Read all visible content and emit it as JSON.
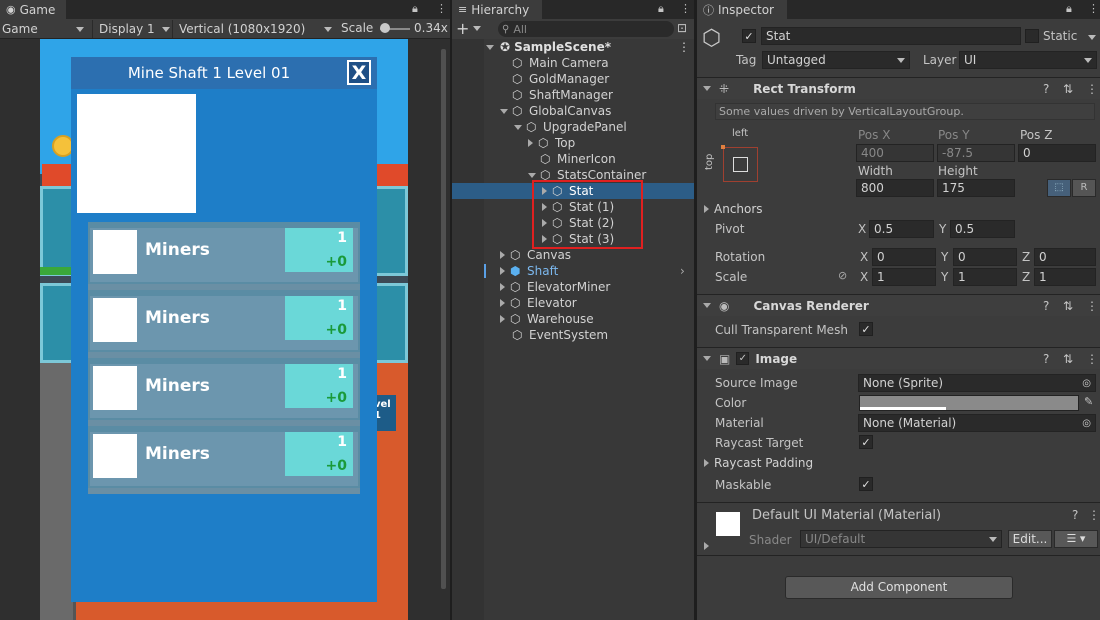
{
  "game": {
    "tab_label": "Game",
    "mode_label": "Game",
    "display_label": "Display 1",
    "resolution_label": "Vertical (1080x1920)",
    "scale_label": "Scale",
    "scale_value": "0.34x",
    "panel_title": "Mine Shaft 1 Level 01",
    "close_label": "X",
    "stats": [
      {
        "name": "Miners",
        "value": "1",
        "delta": "+0"
      },
      {
        "name": "Miners",
        "value": "1",
        "delta": "+0"
      },
      {
        "name": "Miners",
        "value": "1",
        "delta": "+0"
      },
      {
        "name": "Miners",
        "value": "1",
        "delta": "+0"
      }
    ],
    "bg_level_text": "vel",
    "bg_level_num": "1"
  },
  "hierarchy": {
    "tab_label": "Hierarchy",
    "search_placeholder": "All",
    "add_label": "+",
    "scene_name": "SampleScene*",
    "items": [
      {
        "label": "Main Camera"
      },
      {
        "label": "GoldManager"
      },
      {
        "label": "ShaftManager"
      },
      {
        "label": "GlobalCanvas"
      },
      {
        "label": "UpgradePanel"
      },
      {
        "label": "Top"
      },
      {
        "label": "MinerIcon"
      },
      {
        "label": "StatsContainer"
      },
      {
        "label": "Stat"
      },
      {
        "label": "Stat (1)"
      },
      {
        "label": "Stat (2)"
      },
      {
        "label": "Stat (3)"
      },
      {
        "label": "Canvas"
      },
      {
        "label": "Shaft"
      },
      {
        "label": "ElevatorMiner"
      },
      {
        "label": "Elevator"
      },
      {
        "label": "Warehouse"
      },
      {
        "label": "EventSystem"
      }
    ],
    "highlight_color": "#e02020",
    "selected_color": "#2c5d87"
  },
  "inspector": {
    "tab_label": "Inspector",
    "object_name": "Stat",
    "static_label": "Static",
    "tag_label": "Tag",
    "tag_value": "Untagged",
    "layer_label": "Layer",
    "layer_value": "UI",
    "rect_transform": {
      "title": "Rect Transform",
      "note": "Some values driven by VerticalLayoutGroup.",
      "anchor_h": "left",
      "anchor_v": "top",
      "posx_label": "Pos X",
      "posy_label": "Pos Y",
      "posz_label": "Pos Z",
      "posx": "400",
      "posy": "-87.5",
      "posz": "0",
      "width_label": "Width",
      "height_label": "Height",
      "width": "800",
      "height": "175",
      "r_label": "R",
      "anchors_label": "Anchors",
      "pivot_label": "Pivot",
      "pivot_x": "0.5",
      "pivot_y": "0.5",
      "rotation_label": "Rotation",
      "rot_x": "0",
      "rot_y": "0",
      "rot_z": "0",
      "scale_label": "Scale",
      "scale_x": "1",
      "scale_y": "1",
      "scale_z": "1",
      "x": "X",
      "y": "Y",
      "z": "Z"
    },
    "canvas_renderer": {
      "title": "Canvas Renderer",
      "cull_label": "Cull Transparent Mesh"
    },
    "image": {
      "title": "Image",
      "source_label": "Source Image",
      "source_value": "None (Sprite)",
      "color_label": "Color",
      "material_label": "Material",
      "material_value": "None (Material)",
      "raycast_target_label": "Raycast Target",
      "raycast_padding_label": "Raycast Padding",
      "maskable_label": "Maskable"
    },
    "material": {
      "title": "Default UI Material (Material)",
      "shader_label": "Shader",
      "shader_value": "UI/Default",
      "edit_label": "Edit..."
    },
    "add_component_label": "Add Component"
  }
}
